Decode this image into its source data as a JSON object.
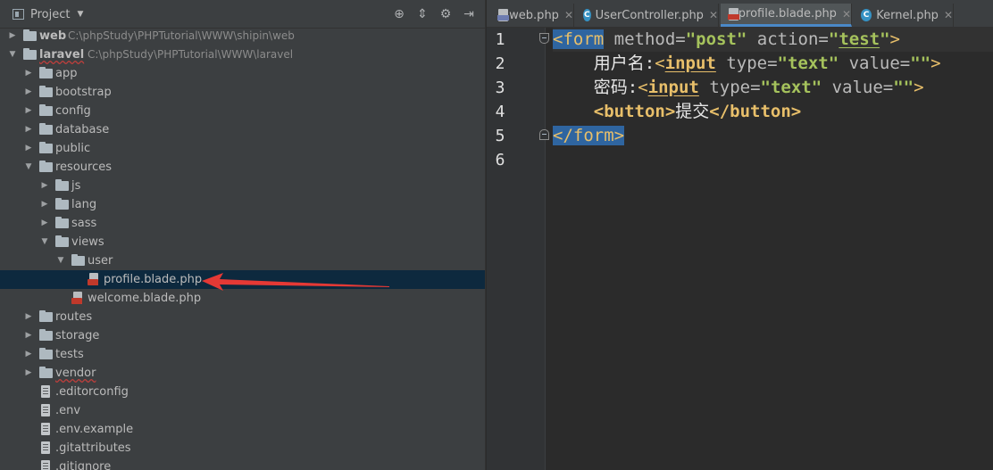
{
  "project_panel": {
    "title": "Project",
    "tools": [
      "target-icon",
      "collapse-icon",
      "gear-icon",
      "hide-icon"
    ],
    "tree": [
      {
        "id": "web",
        "label": "web",
        "path": "C:\\phpStudy\\PHPTutorial\\WWW\\shipin\\web",
        "depth": 0,
        "expanded": false,
        "type": "root"
      },
      {
        "id": "laravel",
        "label": "laravel",
        "path": "C:\\phpStudy\\PHPTutorial\\WWW\\laravel",
        "depth": 0,
        "expanded": true,
        "type": "root"
      },
      {
        "id": "app",
        "label": "app",
        "depth": 1,
        "expanded": false,
        "type": "folder"
      },
      {
        "id": "bootstrap",
        "label": "bootstrap",
        "depth": 1,
        "expanded": false,
        "type": "folder"
      },
      {
        "id": "config",
        "label": "config",
        "depth": 1,
        "expanded": false,
        "type": "folder"
      },
      {
        "id": "database",
        "label": "database",
        "depth": 1,
        "expanded": false,
        "type": "folder"
      },
      {
        "id": "public",
        "label": "public",
        "depth": 1,
        "expanded": false,
        "type": "folder"
      },
      {
        "id": "resources",
        "label": "resources",
        "depth": 1,
        "expanded": true,
        "type": "folder"
      },
      {
        "id": "js",
        "label": "js",
        "depth": 2,
        "expanded": false,
        "type": "folder"
      },
      {
        "id": "lang",
        "label": "lang",
        "depth": 2,
        "expanded": false,
        "type": "folder"
      },
      {
        "id": "sass",
        "label": "sass",
        "depth": 2,
        "expanded": false,
        "type": "folder"
      },
      {
        "id": "views",
        "label": "views",
        "depth": 2,
        "expanded": true,
        "type": "folder"
      },
      {
        "id": "user",
        "label": "user",
        "depth": 3,
        "expanded": true,
        "type": "folder"
      },
      {
        "id": "profile-blade",
        "label": "profile.blade.php",
        "depth": 4,
        "type": "blade",
        "selected": true
      },
      {
        "id": "welcome-blade",
        "label": "welcome.blade.php",
        "depth": 3,
        "type": "blade"
      },
      {
        "id": "routes",
        "label": "routes",
        "depth": 1,
        "expanded": false,
        "type": "folder"
      },
      {
        "id": "storage",
        "label": "storage",
        "depth": 1,
        "expanded": false,
        "type": "folder"
      },
      {
        "id": "tests",
        "label": "tests",
        "depth": 1,
        "expanded": false,
        "type": "folder"
      },
      {
        "id": "vendor",
        "label": "vendor",
        "depth": 1,
        "expanded": false,
        "type": "folder"
      },
      {
        "id": "editorconfig",
        "label": ".editorconfig",
        "depth": 1,
        "type": "file"
      },
      {
        "id": "env",
        "label": ".env",
        "depth": 1,
        "type": "file"
      },
      {
        "id": "env-example",
        "label": ".env.example",
        "depth": 1,
        "type": "file"
      },
      {
        "id": "gitattributes",
        "label": ".gitattributes",
        "depth": 1,
        "type": "file"
      },
      {
        "id": "gitignore",
        "label": ".gitignore",
        "depth": 1,
        "type": "file"
      }
    ]
  },
  "editor": {
    "tabs": [
      {
        "label": "web.php",
        "icon": "php-file-icon",
        "active": false
      },
      {
        "label": "UserController.php",
        "icon": "class-icon",
        "active": false
      },
      {
        "label": "profile.blade.php",
        "icon": "blade-file-icon",
        "active": true
      },
      {
        "label": "Kernel.php",
        "icon": "class-icon",
        "active": false
      }
    ],
    "line_numbers": [
      "1",
      "2",
      "3",
      "4",
      "5",
      "6"
    ],
    "code": {
      "l1": {
        "open": "<form",
        "a1": " method=",
        "v1": "\"post\"",
        "a2": " action=",
        "q1": "\"",
        "v2": "test",
        "q2": "\"",
        "close": ">"
      },
      "l2": {
        "label": "用户名:",
        "open": "<",
        "tag": "input",
        "a1": " type=",
        "v1": "\"text\"",
        "a2": " value=",
        "v2": "\"\"",
        "close": ">"
      },
      "l3": {
        "label": "密码:",
        "open": "<",
        "tag": "input",
        "a1": " type=",
        "v1": "\"text\"",
        "a2": " value=",
        "v2": "\"\"",
        "close": ">"
      },
      "l4": {
        "open": "<button>",
        "label": "提交",
        "close": "</button>"
      },
      "l5": {
        "close": "</form>"
      }
    }
  },
  "colors": {
    "panel_bg": "#3c3f41",
    "editor_bg": "#2b2b2b",
    "selection": "#0d293e",
    "tag": "#e8bf6a",
    "string": "#a5c25c",
    "active_tab_underline": "#4a88c7",
    "annotation_arrow": "#e53935"
  }
}
